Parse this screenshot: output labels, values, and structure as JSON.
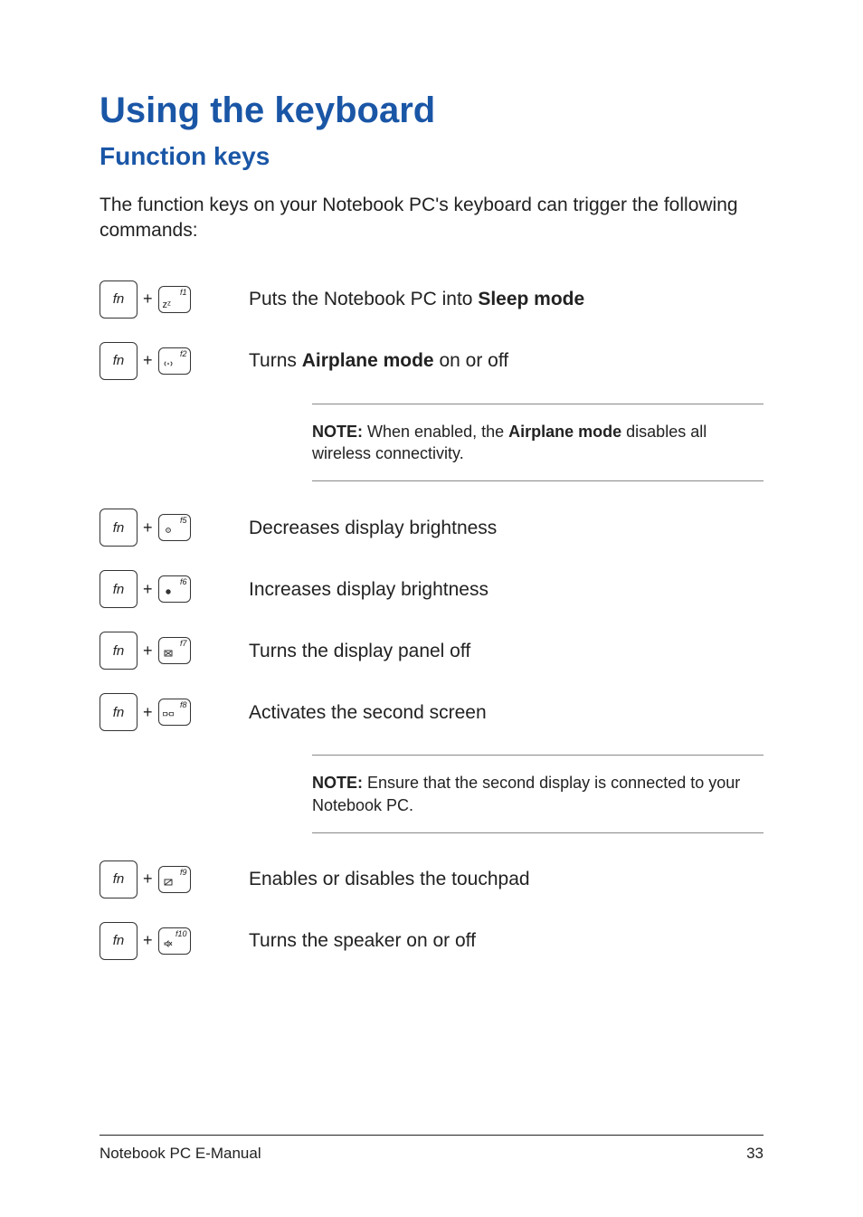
{
  "title": "Using the keyboard",
  "subtitle": "Function keys",
  "intro": "The function keys on your Notebook PC's keyboard can trigger the following commands:",
  "fn_label": "fn",
  "plus": "+",
  "rows": {
    "f1": {
      "num": "f1",
      "glyph": "zᶻ",
      "desc_pre": "Puts the Notebook PC into ",
      "desc_bold": "Sleep mode",
      "desc_post": ""
    },
    "f2": {
      "num": "f2",
      "glyph": "📶",
      "desc_pre": "Turns ",
      "desc_bold": "Airplane mode",
      "desc_post": " on or off"
    },
    "f5": {
      "num": "f5",
      "glyph": "☼",
      "desc": "Decreases display brightness"
    },
    "f6": {
      "num": "f6",
      "glyph": "☀",
      "desc": "Increases display brightness"
    },
    "f7": {
      "num": "f7",
      "glyph": "⊠",
      "desc": "Turns the display panel off"
    },
    "f8": {
      "num": "f8",
      "glyph": "▭/▭",
      "desc": "Activates the second screen"
    },
    "f9": {
      "num": "f9",
      "glyph": "⊘",
      "desc": "Enables or disables the touchpad"
    },
    "f10": {
      "num": "f10",
      "glyph": "🔇",
      "desc": "Turns the speaker on or off"
    }
  },
  "notes": {
    "airplane": {
      "label": "NOTE:",
      "pre": " When enabled, the ",
      "bold": "Airplane mode",
      "post": " disables all wireless connectivity."
    },
    "second_screen": {
      "label": "NOTE:",
      "body": " Ensure that the second display is connected to your Notebook PC."
    }
  },
  "footer": {
    "left": "Notebook PC E-Manual",
    "right": "33"
  }
}
